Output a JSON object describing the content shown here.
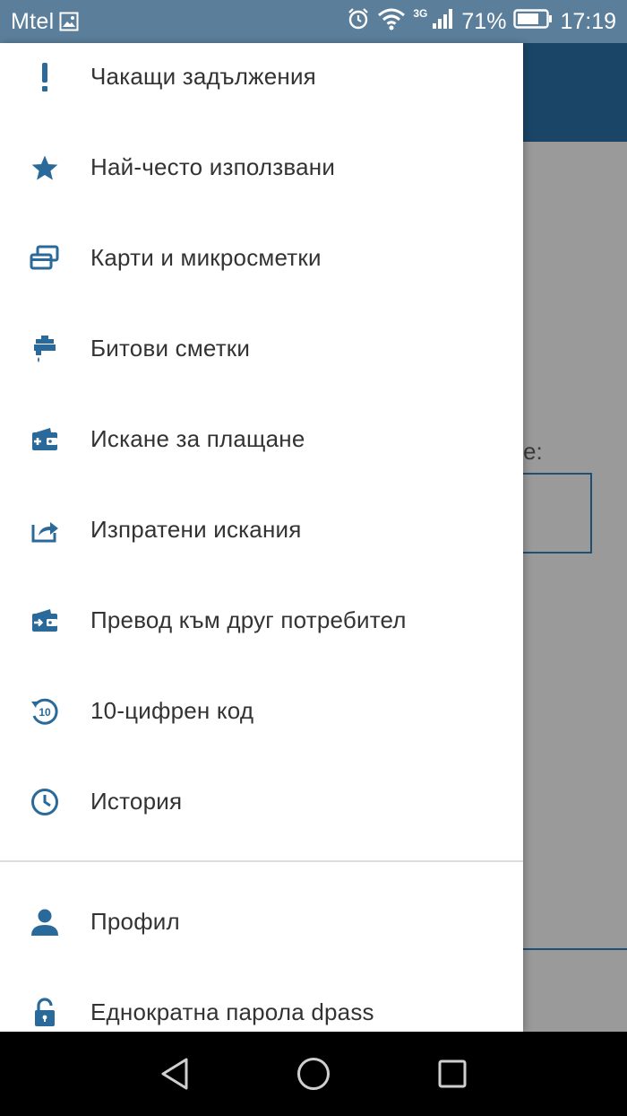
{
  "status_bar": {
    "carrier": "Mtel",
    "network": "3G",
    "battery": "71%",
    "time": "17:19"
  },
  "drawer": {
    "items": [
      {
        "label": "Чакащи задължения",
        "icon": "exclamation-icon"
      },
      {
        "label": "Най-често използвани",
        "icon": "star-icon"
      },
      {
        "label": "Карти и микросметки",
        "icon": "cards-icon"
      },
      {
        "label": "Битови сметки",
        "icon": "faucet-icon"
      },
      {
        "label": "Искане за плащане",
        "icon": "wallet-add-icon"
      },
      {
        "label": "Изпратени искания",
        "icon": "share-icon"
      },
      {
        "label": "Превод към друг потребител",
        "icon": "wallet-transfer-icon"
      },
      {
        "label": "10-цифрен код",
        "icon": "code-10-icon"
      },
      {
        "label": "История",
        "icon": "clock-icon"
      }
    ],
    "bottom_items": [
      {
        "label": "Профил",
        "icon": "person-icon"
      },
      {
        "label": "Еднократна парола dpass",
        "icon": "lock-icon"
      }
    ]
  },
  "background": {
    "label_fragment": "e:"
  },
  "colors": {
    "accent": "#2a6a9a",
    "status_bar": "#5b7f9b",
    "app_bar": "#1a4566"
  }
}
